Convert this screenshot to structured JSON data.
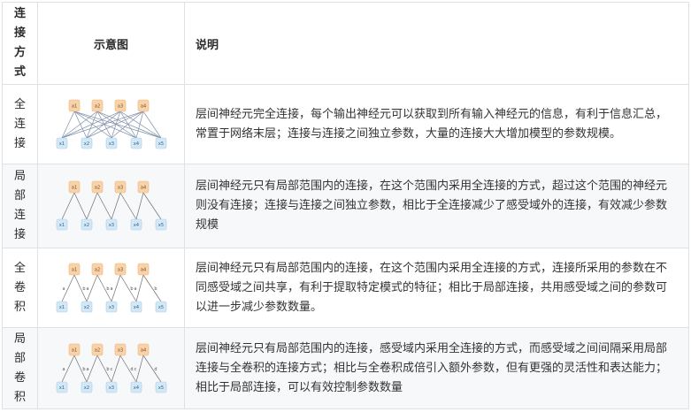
{
  "header": {
    "col1_chars": [
      "连",
      "接",
      "方",
      "式"
    ],
    "col2": "示意图",
    "col3": "说明"
  },
  "rows": [
    {
      "name_chars": [
        "全",
        "连",
        "接"
      ],
      "diagram_icon": "fully-connected-diagram",
      "top_nodes": [
        "a1",
        "a2",
        "a3",
        "a4"
      ],
      "bottom_nodes": [
        "x1",
        "x2",
        "x3",
        "x4",
        "x5"
      ],
      "description": "层间神经元完全连接，每个输出神经元可以获取到所有输入神经元的信息，有利于信息汇总，常置于网络末层；连接与连接之间独立参数，大量的连接大大增加模型的参数规模。"
    },
    {
      "name_chars": [
        "局",
        "部",
        "连",
        "接"
      ],
      "diagram_icon": "locally-connected-diagram",
      "top_nodes": [
        "a1",
        "a2",
        "a3",
        "a4"
      ],
      "bottom_nodes": [
        "x1",
        "x2",
        "x3",
        "x4",
        "x5"
      ],
      "description": "层间神经元只有局部范围内的连接，在这个范围内采用全连接的方式，超过这个范围的神经元则没有连接；连接与连接之间独立参数，相比于全连接减少了感受域外的连接，有效减少参数规模"
    },
    {
      "name_chars": [
        "全",
        "卷",
        "积"
      ],
      "diagram_icon": "convolution-diagram",
      "top_nodes": [
        "a1",
        "a2",
        "a3",
        "a4"
      ],
      "bottom_nodes": [
        "x1",
        "x2",
        "x3",
        "x4",
        "x5"
      ],
      "edge_labels": [
        "a",
        "b",
        "a",
        "b",
        "a",
        "b",
        "a",
        "b"
      ],
      "description": "层间神经元只有局部范围内的连接，在这个范围内采用全连接的方式，连接所采用的参数在不同感受域之间共享，有利于提取特定模式的特征；相比于局部连接，共用感受域之间的参数可以进一步减少参数数量。"
    },
    {
      "name_chars": [
        "局",
        "部",
        "卷",
        "积"
      ],
      "diagram_icon": "local-convolution-diagram",
      "top_nodes": [
        "a1",
        "a2",
        "a3",
        "a4"
      ],
      "bottom_nodes": [
        "x1",
        "x2",
        "x3",
        "x4",
        "x5"
      ],
      "edge_labels": [
        "a",
        "b",
        "a",
        "b",
        "c",
        "d",
        "c",
        "d"
      ],
      "description": "层间神经元只有局部范围内的连接，感受域内采用全连接的方式，而感受域之间间隔采用局部连接与全卷积的连接方式；相比与全卷积成倍引入额外参数，但有更强的灵活性和表达能力；相比于局部连接，可以有效控制参数数量"
    }
  ],
  "colors": {
    "top_node_fill": "#f9d2a8",
    "top_node_stroke": "#efb57a",
    "bottom_node_fill": "#d3e8f7",
    "bottom_node_stroke": "#a9cde9",
    "edge_fc": "#7f8fa8",
    "edge_local": "#707070"
  }
}
